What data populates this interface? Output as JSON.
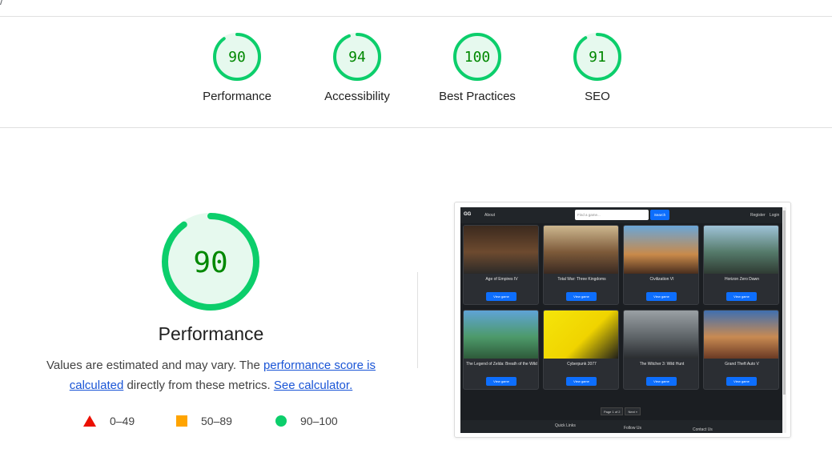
{
  "url_fragment": "/",
  "categories": [
    {
      "score": "90",
      "label": "Performance",
      "fraction": 0.9
    },
    {
      "score": "94",
      "label": "Accessibility",
      "fraction": 0.94
    },
    {
      "score": "100",
      "label": "Best Practices",
      "fraction": 1.0
    },
    {
      "score": "91",
      "label": "SEO",
      "fraction": 0.91
    }
  ],
  "performance": {
    "score": "90",
    "fraction": 0.9,
    "title": "Performance",
    "desc_prefix": "Values are estimated and may vary. The ",
    "desc_link1": "performance score is calculated",
    "desc_middle": " directly from these metrics. ",
    "desc_link2": "See calculator."
  },
  "legend": [
    {
      "shape": "triangle",
      "range": "0–49",
      "color": "#eb0f00"
    },
    {
      "shape": "square",
      "range": "50–89",
      "color": "#ffa400"
    },
    {
      "shape": "circle",
      "range": "90–100",
      "color": "#0cce6b"
    }
  ],
  "colors": {
    "pass": "#0cce6b",
    "pass_text": "#008800",
    "pass_bg": "#e6f9ee",
    "link": "#1a55d6"
  },
  "thumbnail": {
    "nav": {
      "brand": "GG",
      "about": "About",
      "search_placeholder": "Find a game...",
      "search_button": "Search",
      "register": "Register",
      "login": "Login"
    },
    "cards": [
      {
        "title": "Age of Empires IV",
        "button": "View game"
      },
      {
        "title": "Total War: Three Kingdoms",
        "button": "View game"
      },
      {
        "title": "Civilization VI",
        "button": "View game"
      },
      {
        "title": "Horizon Zero Dawn",
        "button": "View game"
      },
      {
        "title": "The Legend of Zelda: Breath of the Wild",
        "button": "View game"
      },
      {
        "title": "Cyberpunk 2077",
        "button": "View game"
      },
      {
        "title": "The Witcher 3: Wild Hunt",
        "button": "View game"
      },
      {
        "title": "Grand Theft Auto V",
        "button": "View game"
      }
    ],
    "pager": {
      "page_text": "Page 1 of 2",
      "next": "Next »"
    },
    "footer": {
      "quick_links": "Quick Links",
      "follow_us": "Follow Us",
      "contact_us": "Contact Us"
    }
  }
}
